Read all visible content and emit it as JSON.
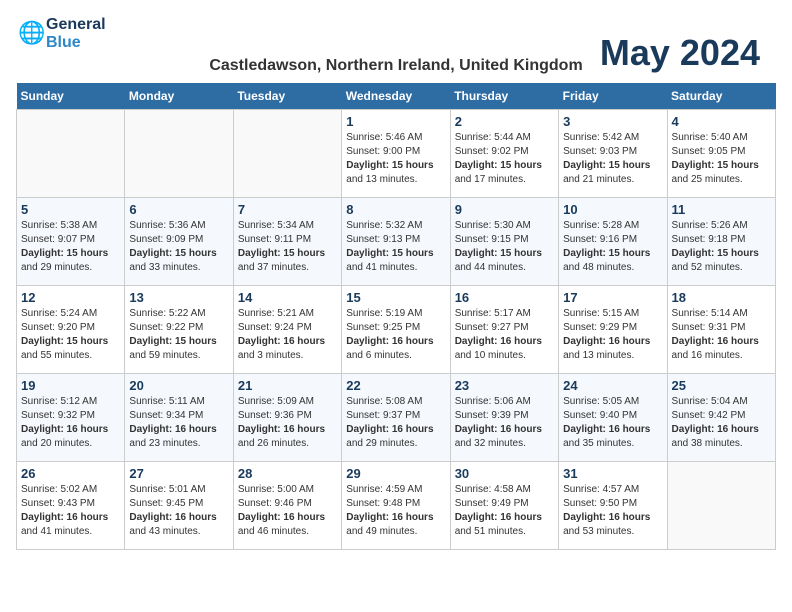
{
  "header": {
    "logo_line1": "General",
    "logo_line2": "Blue",
    "month_year": "May 2024",
    "location": "Castledawson, Northern Ireland, United Kingdom"
  },
  "weekdays": [
    "Sunday",
    "Monday",
    "Tuesday",
    "Wednesday",
    "Thursday",
    "Friday",
    "Saturday"
  ],
  "weeks": [
    [
      {
        "day": "",
        "info": ""
      },
      {
        "day": "",
        "info": ""
      },
      {
        "day": "",
        "info": ""
      },
      {
        "day": "1",
        "info": "Sunrise: 5:46 AM\nSunset: 9:00 PM\nDaylight: 15 hours\nand 13 minutes."
      },
      {
        "day": "2",
        "info": "Sunrise: 5:44 AM\nSunset: 9:02 PM\nDaylight: 15 hours\nand 17 minutes."
      },
      {
        "day": "3",
        "info": "Sunrise: 5:42 AM\nSunset: 9:03 PM\nDaylight: 15 hours\nand 21 minutes."
      },
      {
        "day": "4",
        "info": "Sunrise: 5:40 AM\nSunset: 9:05 PM\nDaylight: 15 hours\nand 25 minutes."
      }
    ],
    [
      {
        "day": "5",
        "info": "Sunrise: 5:38 AM\nSunset: 9:07 PM\nDaylight: 15 hours\nand 29 minutes."
      },
      {
        "day": "6",
        "info": "Sunrise: 5:36 AM\nSunset: 9:09 PM\nDaylight: 15 hours\nand 33 minutes."
      },
      {
        "day": "7",
        "info": "Sunrise: 5:34 AM\nSunset: 9:11 PM\nDaylight: 15 hours\nand 37 minutes."
      },
      {
        "day": "8",
        "info": "Sunrise: 5:32 AM\nSunset: 9:13 PM\nDaylight: 15 hours\nand 41 minutes."
      },
      {
        "day": "9",
        "info": "Sunrise: 5:30 AM\nSunset: 9:15 PM\nDaylight: 15 hours\nand 44 minutes."
      },
      {
        "day": "10",
        "info": "Sunrise: 5:28 AM\nSunset: 9:16 PM\nDaylight: 15 hours\nand 48 minutes."
      },
      {
        "day": "11",
        "info": "Sunrise: 5:26 AM\nSunset: 9:18 PM\nDaylight: 15 hours\nand 52 minutes."
      }
    ],
    [
      {
        "day": "12",
        "info": "Sunrise: 5:24 AM\nSunset: 9:20 PM\nDaylight: 15 hours\nand 55 minutes."
      },
      {
        "day": "13",
        "info": "Sunrise: 5:22 AM\nSunset: 9:22 PM\nDaylight: 15 hours\nand 59 minutes."
      },
      {
        "day": "14",
        "info": "Sunrise: 5:21 AM\nSunset: 9:24 PM\nDaylight: 16 hours\nand 3 minutes."
      },
      {
        "day": "15",
        "info": "Sunrise: 5:19 AM\nSunset: 9:25 PM\nDaylight: 16 hours\nand 6 minutes."
      },
      {
        "day": "16",
        "info": "Sunrise: 5:17 AM\nSunset: 9:27 PM\nDaylight: 16 hours\nand 10 minutes."
      },
      {
        "day": "17",
        "info": "Sunrise: 5:15 AM\nSunset: 9:29 PM\nDaylight: 16 hours\nand 13 minutes."
      },
      {
        "day": "18",
        "info": "Sunrise: 5:14 AM\nSunset: 9:31 PM\nDaylight: 16 hours\nand 16 minutes."
      }
    ],
    [
      {
        "day": "19",
        "info": "Sunrise: 5:12 AM\nSunset: 9:32 PM\nDaylight: 16 hours\nand 20 minutes."
      },
      {
        "day": "20",
        "info": "Sunrise: 5:11 AM\nSunset: 9:34 PM\nDaylight: 16 hours\nand 23 minutes."
      },
      {
        "day": "21",
        "info": "Sunrise: 5:09 AM\nSunset: 9:36 PM\nDaylight: 16 hours\nand 26 minutes."
      },
      {
        "day": "22",
        "info": "Sunrise: 5:08 AM\nSunset: 9:37 PM\nDaylight: 16 hours\nand 29 minutes."
      },
      {
        "day": "23",
        "info": "Sunrise: 5:06 AM\nSunset: 9:39 PM\nDaylight: 16 hours\nand 32 minutes."
      },
      {
        "day": "24",
        "info": "Sunrise: 5:05 AM\nSunset: 9:40 PM\nDaylight: 16 hours\nand 35 minutes."
      },
      {
        "day": "25",
        "info": "Sunrise: 5:04 AM\nSunset: 9:42 PM\nDaylight: 16 hours\nand 38 minutes."
      }
    ],
    [
      {
        "day": "26",
        "info": "Sunrise: 5:02 AM\nSunset: 9:43 PM\nDaylight: 16 hours\nand 41 minutes."
      },
      {
        "day": "27",
        "info": "Sunrise: 5:01 AM\nSunset: 9:45 PM\nDaylight: 16 hours\nand 43 minutes."
      },
      {
        "day": "28",
        "info": "Sunrise: 5:00 AM\nSunset: 9:46 PM\nDaylight: 16 hours\nand 46 minutes."
      },
      {
        "day": "29",
        "info": "Sunrise: 4:59 AM\nSunset: 9:48 PM\nDaylight: 16 hours\nand 49 minutes."
      },
      {
        "day": "30",
        "info": "Sunrise: 4:58 AM\nSunset: 9:49 PM\nDaylight: 16 hours\nand 51 minutes."
      },
      {
        "day": "31",
        "info": "Sunrise: 4:57 AM\nSunset: 9:50 PM\nDaylight: 16 hours\nand 53 minutes."
      },
      {
        "day": "",
        "info": ""
      }
    ]
  ]
}
